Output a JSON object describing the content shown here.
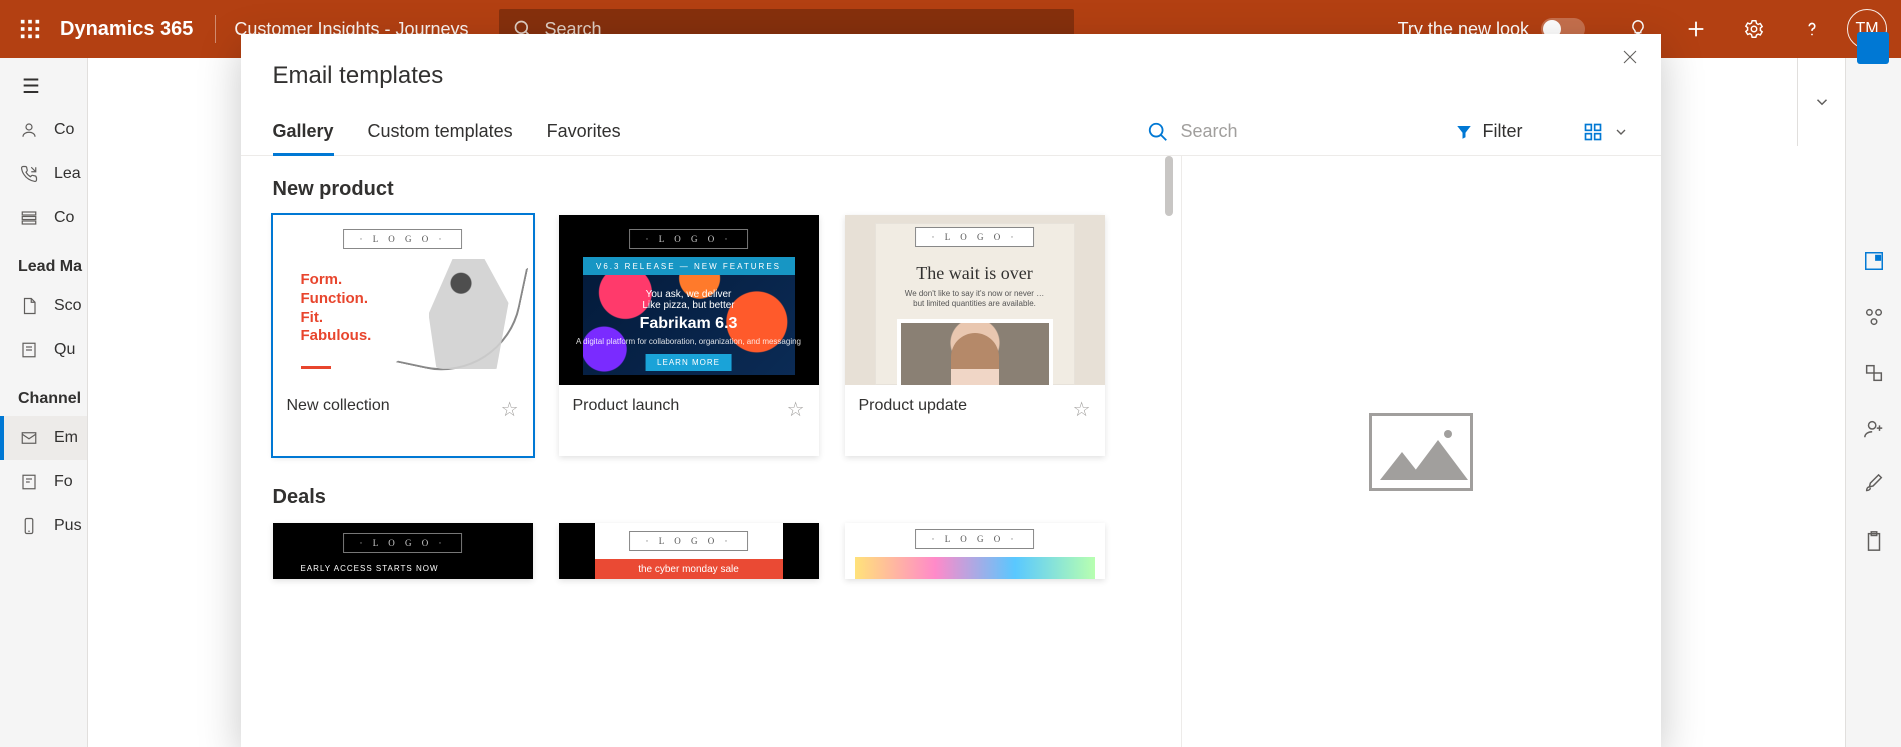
{
  "topbar": {
    "brand": "Dynamics 365",
    "subtitle": "Customer Insights - Journeys",
    "search_placeholder": "Search",
    "try_new_look": "Try the new look",
    "avatar_initials": "TM"
  },
  "leftnav": {
    "items_top": [
      {
        "icon": "person",
        "label": "Co"
      },
      {
        "icon": "phone-in",
        "label": "Lea"
      },
      {
        "icon": "list",
        "label": "Co"
      }
    ],
    "section1": "Lead Ma",
    "items_mid": [
      {
        "icon": "doc",
        "label": "Sco"
      },
      {
        "icon": "note",
        "label": "Qu"
      }
    ],
    "section2": "Channel",
    "items_bot": [
      {
        "icon": "mail",
        "label": "Em",
        "selected": true
      },
      {
        "icon": "form",
        "label": "Fo"
      },
      {
        "icon": "device",
        "label": "Pus"
      }
    ]
  },
  "modal": {
    "title": "Email templates",
    "tabs": [
      "Gallery",
      "Custom templates",
      "Favorites"
    ],
    "active_tab": 0,
    "search_placeholder": "Search",
    "filter_label": "Filter",
    "sections": [
      {
        "title": "New product",
        "cards": [
          {
            "name": "New collection",
            "selected": true,
            "thumb": {
              "logo": "· L O G O ·",
              "lines": [
                "Form.",
                "Function.",
                "Fit.",
                "Fabulous."
              ]
            }
          },
          {
            "name": "Product launch",
            "thumb": {
              "logo": "· L O G O ·",
              "banner": "V6.3 RELEASE — NEW FEATURES",
              "line1": "You ask, we deliver",
              "line2": "Like pizza, but better",
              "heading": "Fabrikam 6.3",
              "line3": "A digital platform for collaboration, organization, and messaging",
              "cta": "LEARN MORE"
            }
          },
          {
            "name": "Product update",
            "thumb": {
              "logo": "· L O G O ·",
              "heading": "The wait is over",
              "sub1": "We don't like to say it's now or never …",
              "sub2": "but limited quantities are available."
            }
          }
        ]
      },
      {
        "title": "Deals",
        "cards": [
          {
            "name": "",
            "thumb": {
              "logo": "· L O G O ·",
              "caption": "EARLY ACCESS STARTS NOW"
            }
          },
          {
            "name": "",
            "thumb": {
              "logo": "· L O G O ·",
              "redbar": "the cyber monday sale"
            }
          },
          {
            "name": "",
            "thumb": {
              "logo": "· L O G O ·"
            }
          }
        ]
      }
    ]
  }
}
